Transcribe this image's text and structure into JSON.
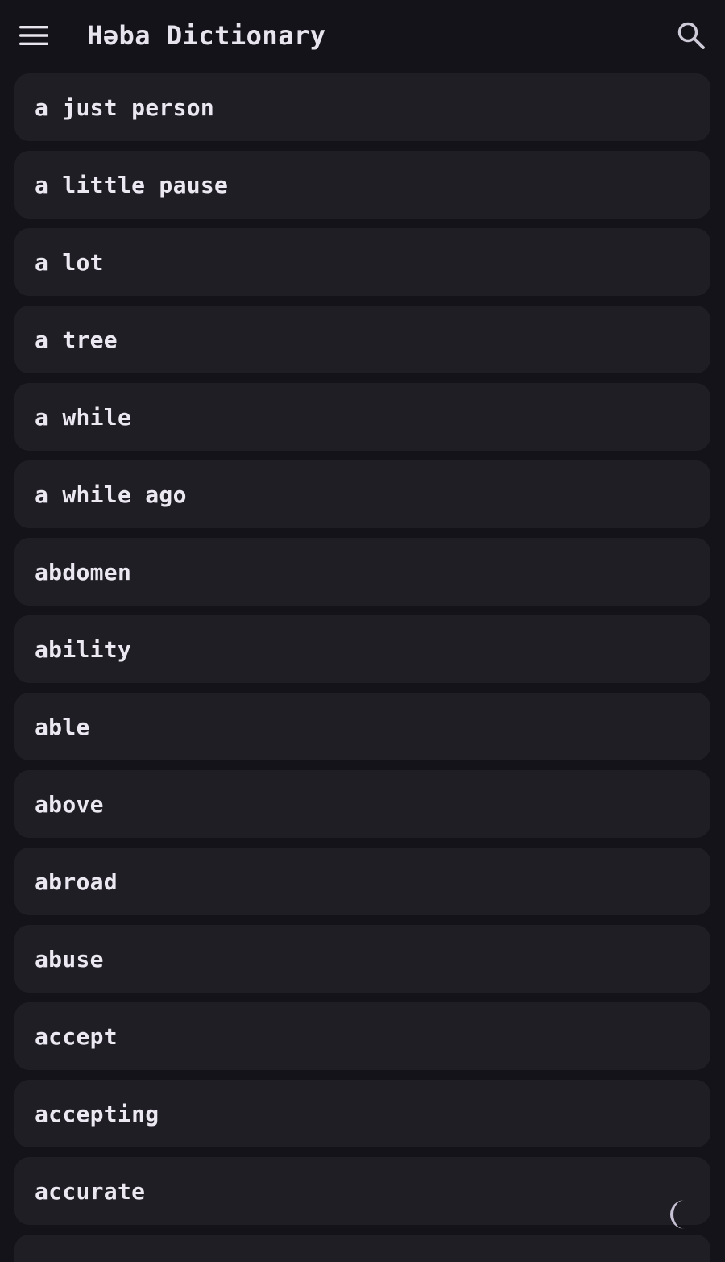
{
  "app": {
    "title": "Həba Dictionary"
  },
  "icons": {
    "menu": "hamburger-menu-icon",
    "search": "search-icon",
    "theme": "moon-icon"
  },
  "colors": {
    "background": "#141319",
    "card": "#1f1e24",
    "text": "#ece8f2",
    "moon": "#c9c2d6"
  },
  "words": [
    "a just person",
    "a little pause",
    "a lot",
    "a tree",
    "a while",
    "a while ago",
    "abdomen",
    "ability",
    "able",
    "above",
    "abroad",
    "abuse",
    "accept",
    "accepting",
    "accurate",
    ""
  ]
}
